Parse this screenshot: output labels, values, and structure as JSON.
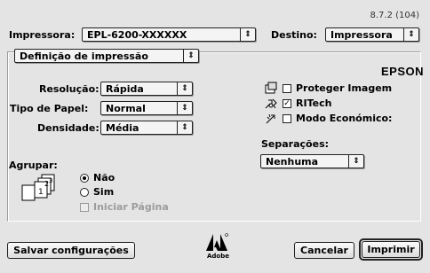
{
  "version": "8.7.2 (104)",
  "printer": {
    "label": "Impressora:",
    "value": "EPL-6200-XXXXXX"
  },
  "destination": {
    "label": "Destino:",
    "value": "Impressora"
  },
  "panel_menu": {
    "value": "Definição de impressão"
  },
  "brand": "EPSON",
  "settings": {
    "resolution": {
      "label": "Resolução:",
      "value": "Rápida"
    },
    "paper_type": {
      "label": "Tipo de Papel:",
      "value": "Normal"
    },
    "density": {
      "label": "Densidade:",
      "value": "Média"
    }
  },
  "options": {
    "protect_image": {
      "label": "Proteger Imagem",
      "checked": false
    },
    "ritech": {
      "label": "RITech",
      "checked": true
    },
    "economy_mode": {
      "label": "Modo Económico:",
      "checked": false
    }
  },
  "separations": {
    "label": "Separações:",
    "value": "Nenhuma"
  },
  "collate": {
    "label": "Agrupar:",
    "no_label": "Não",
    "yes_label": "Sim",
    "selected": "Não",
    "start_page_label": "Iniciar Página"
  },
  "buttons": {
    "save_settings": "Salvar configurações",
    "cancel": "Cancelar",
    "print": "Imprimir"
  },
  "adobe_label": "Adobe",
  "glyphs": {
    "popup_arrows": "⇕",
    "check_mark": "✓"
  }
}
